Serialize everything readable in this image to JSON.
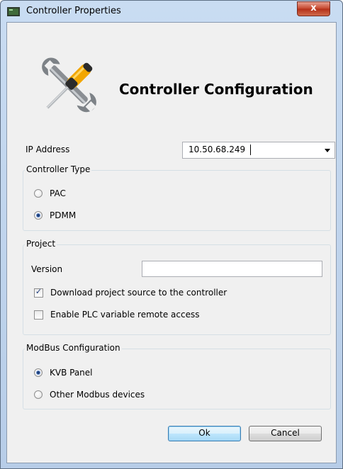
{
  "window": {
    "title": "Controller Properties",
    "close_label": "x"
  },
  "header": {
    "heading": "Controller Configuration"
  },
  "ip": {
    "label": "IP Address",
    "value": "10.50.68.249"
  },
  "controller_type": {
    "title": "Controller Type",
    "options": [
      "PAC",
      "PDMM"
    ],
    "selected": "PDMM"
  },
  "project": {
    "title": "Project",
    "version_label": "Version",
    "version_value": "",
    "download_label": "Download project source to the controller",
    "download_checked": true,
    "plc_label": "Enable PLC variable remote access",
    "plc_checked": false
  },
  "modbus": {
    "title": "ModBus Configuration",
    "options": [
      "KVB Panel",
      "Other Modbus devices"
    ],
    "selected": "KVB Panel"
  },
  "buttons": {
    "ok": "Ok",
    "cancel": "Cancel"
  },
  "colors": {
    "title_bar": "#c9dcf2",
    "client_bg": "#f0f0f0",
    "close_button": "#c4442a",
    "default_button": "#bee6fd"
  }
}
